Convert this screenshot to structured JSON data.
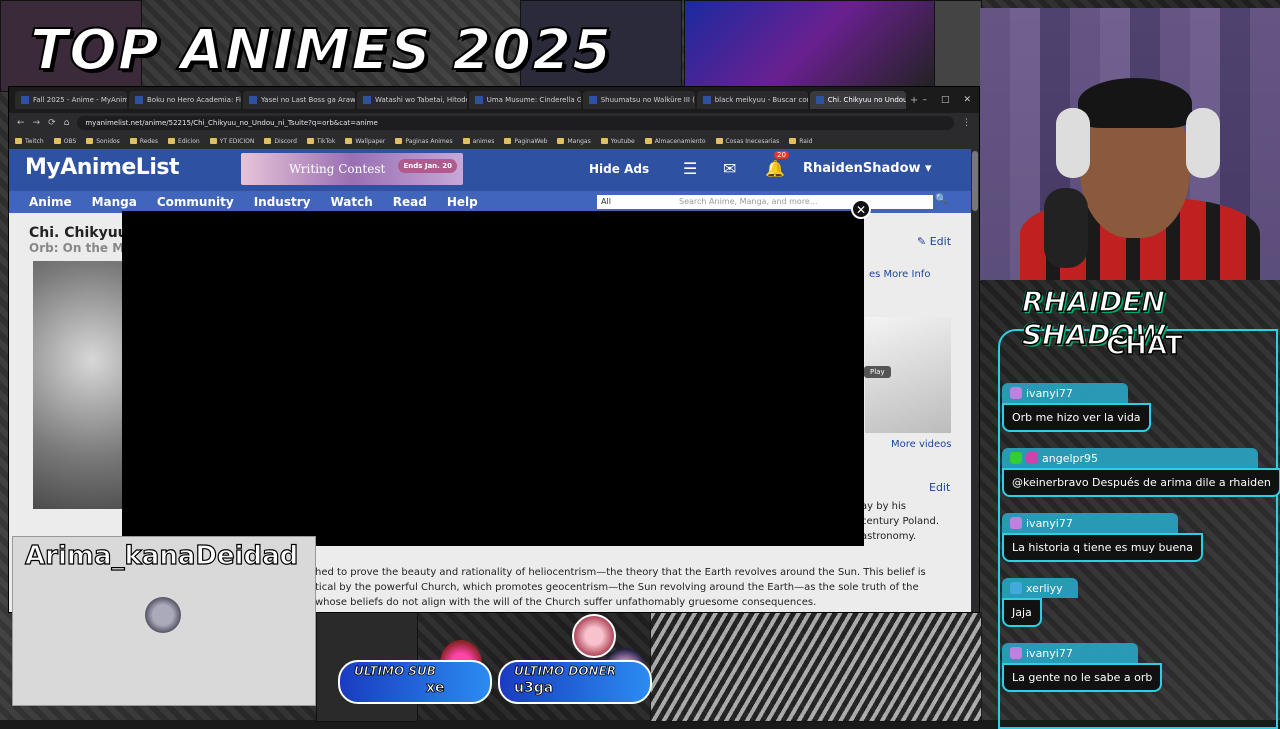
{
  "overlay_title": "TOP ANIMES 2025",
  "browser": {
    "tabs": [
      {
        "label": "Fall 2025 - Anime - MyAnime",
        "active": false
      },
      {
        "label": "Boku no Hero Academia: Fin",
        "active": false
      },
      {
        "label": "Yasei no Last Boss ga Arawa",
        "active": false
      },
      {
        "label": "Watashi wo Tabetai, Hitode",
        "active": false
      },
      {
        "label": "Uma Musume: Cinderella Gr",
        "active": false
      },
      {
        "label": "Shuumatsu no Walküre III (T",
        "active": false
      },
      {
        "label": "black meikyuu - Buscar con",
        "active": false
      },
      {
        "label": "Chi. Chikyuu no Undou",
        "active": true
      }
    ],
    "new_tab": "+",
    "window_controls": [
      "–",
      "□",
      "✕"
    ],
    "url": "myanimelist.net/anime/52215/Chi_Chikyuu_no_Undou_ni_Tsuite?q=orb&cat=anime",
    "bookmarks": [
      "Twitch",
      "OBS",
      "Sonidos",
      "Redes",
      "Edicion",
      "YT EDICION",
      "Discord",
      "TikTok",
      "Wallpaper",
      "Paginas Animes",
      "animes",
      "PaginaWeb",
      "Mangas",
      "Youtube",
      "Almacenamiento",
      "Cosas Inecesarias",
      "Raid"
    ]
  },
  "mal": {
    "logo": "MyAnimeList",
    "banner_text": "Writing Contest",
    "banner_ends": "Ends Jan. 20",
    "hide_ads": "Hide Ads",
    "notifications": "20",
    "username": "RhaidenShadow",
    "nav": [
      "Anime",
      "Manga",
      "Community",
      "Industry",
      "Watch",
      "Read",
      "Help"
    ],
    "search_category": "All",
    "search_placeholder": "Search Anime, Manga, and more...",
    "title": "Chi. Chikyuu",
    "subtitle": "Orb: On the M",
    "edit": "Edit",
    "more_info_tab": "es  More Info",
    "play": "Play",
    "more_videos": "More videos",
    "edit2": "Edit",
    "synopsis_right": [
      "ay by his",
      "century Poland.",
      "astronomy."
    ],
    "synopsis_lines": [
      "hed to prove the beauty and rationality of heliocentrism—the theory that the Earth revolves around the Sun. This belief is",
      "tical by the powerful Church, which promotes geocentrism—the Sun revolving around the Earth—as the sole truth of the",
      "whose beliefs do not align with the will of the Church suffer unfathomably gruesome consequences."
    ]
  },
  "chat": {
    "heading": "RHAIDEN SHADOW",
    "sub": "CHAT",
    "messages": [
      {
        "user": "ivanyi77",
        "text": "Orb me hizo ver la vida"
      },
      {
        "user": "angelpr95",
        "text": "@keinerbravo Después de arima dile a rhaiden"
      },
      {
        "user": "ivanyi77",
        "text": "La historia q tiene es muy buena"
      },
      {
        "user": "xerliyy",
        "text": "Jaja"
      },
      {
        "user": "ivanyi77",
        "text": "La gente no le sabe a orb"
      }
    ]
  },
  "kana_widget": {
    "name": "Arima_kanaDeidad"
  },
  "last_sub": {
    "label": "ULTIMO SUB",
    "value": "xe"
  },
  "last_donor": {
    "label": "ULTIMO DONER",
    "value": "u3ga"
  },
  "colors": {
    "mal_blue": "#2e51a2",
    "chat_cyan": "#2ad1e6",
    "close_white": "#ffffff"
  }
}
